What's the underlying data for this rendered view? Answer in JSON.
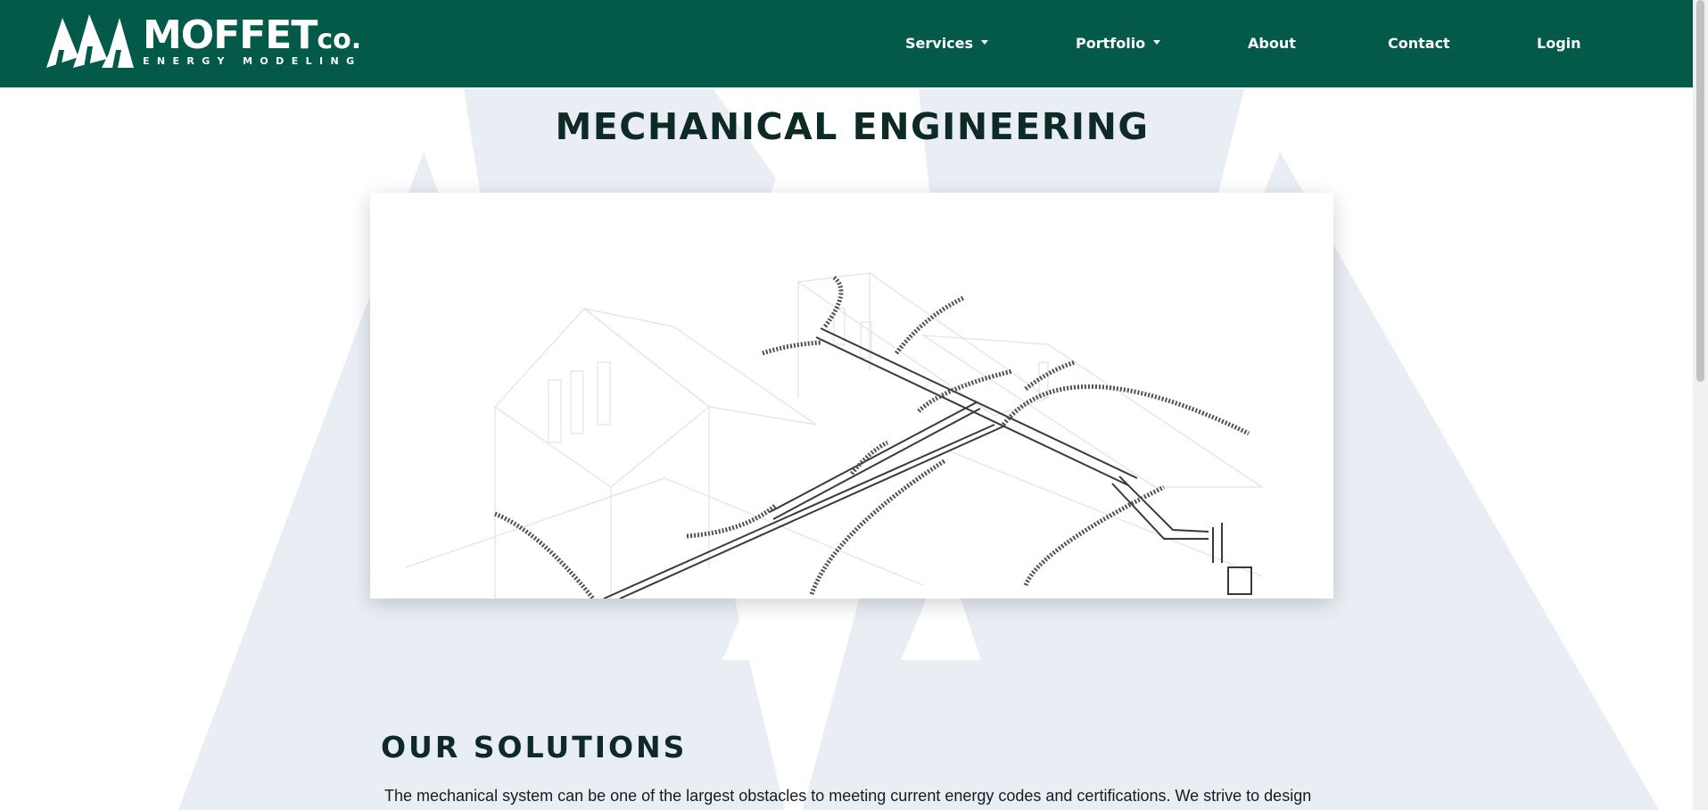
{
  "brand": {
    "name": "MOFFET",
    "suffix": "co.",
    "tagline": "ENERGY MODELING"
  },
  "nav": {
    "items": [
      {
        "label": "Services",
        "has_dropdown": true
      },
      {
        "label": "Portfolio",
        "has_dropdown": true
      },
      {
        "label": "About",
        "has_dropdown": false
      },
      {
        "label": "Contact",
        "has_dropdown": false
      },
      {
        "label": "Login",
        "has_dropdown": false
      }
    ]
  },
  "page": {
    "title": "MECHANICAL ENGINEERING",
    "section_title": "OUR SOLUTIONS",
    "intro": "The mechanical system can be one of the largest obstacles to meeting current energy codes and certifications. We strive to design"
  },
  "colors": {
    "header_bg": "#045a48",
    "background_pattern": "#e9eef5",
    "heading": "#0d2a27"
  },
  "icons": {
    "logo": "triangle-peaks-logo",
    "dropdown": "caret-down-icon"
  }
}
